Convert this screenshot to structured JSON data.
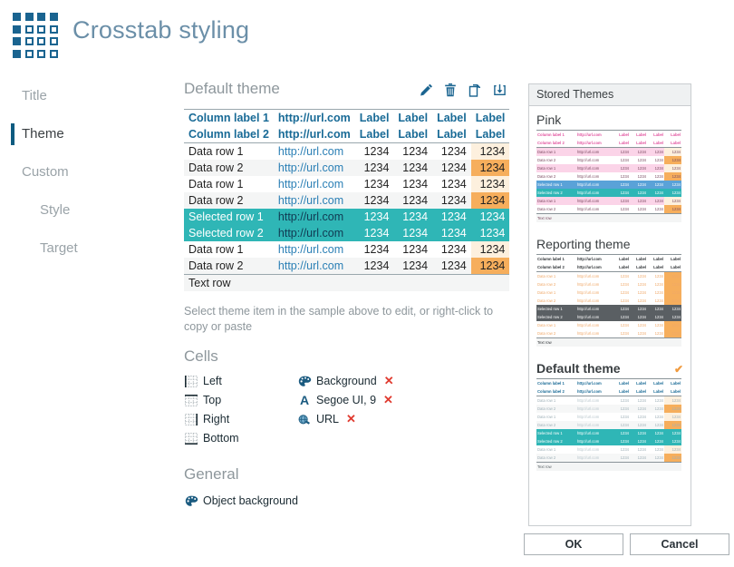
{
  "header": {
    "title": "Crosstab styling",
    "logo_icon": "grid-logo-icon"
  },
  "sidebar": {
    "items": [
      {
        "label": "Title",
        "active": false,
        "indent": false
      },
      {
        "label": "Theme",
        "active": true,
        "indent": false
      },
      {
        "label": "Custom",
        "active": false,
        "indent": false
      },
      {
        "label": "Style",
        "active": false,
        "indent": true
      },
      {
        "label": "Target",
        "active": false,
        "indent": true
      }
    ]
  },
  "main": {
    "panel_title": "Default theme",
    "toolbar": [
      {
        "name": "edit-pencil-icon",
        "tooltip": "Edit"
      },
      {
        "name": "delete-trash-icon",
        "tooltip": "Delete"
      },
      {
        "name": "copy-duplicate-icon",
        "tooltip": "Copy"
      },
      {
        "name": "import-download-icon",
        "tooltip": "Import"
      }
    ],
    "hint": "Select theme item in the sample above to edit, or right-click to copy or paste",
    "sample_table": {
      "rows": [
        {
          "type": "header",
          "cells": [
            "Column label 1",
            "http://url.com",
            "Label",
            "Label",
            "Label",
            "Label"
          ]
        },
        {
          "type": "header",
          "cells": [
            "Column label 2",
            "http://url.com",
            "Label",
            "Label",
            "Label",
            "Label"
          ]
        },
        {
          "type": "data",
          "alt": false,
          "cells": [
            "Data row 1",
            "http://url.com",
            "1234",
            "1234",
            "1234",
            "1234"
          ],
          "hl": "light"
        },
        {
          "type": "data",
          "alt": true,
          "cells": [
            "Data row 2",
            "http://url.com",
            "1234",
            "1234",
            "1234",
            "1234"
          ],
          "hl": "strong"
        },
        {
          "type": "data",
          "alt": false,
          "cells": [
            "Data row 1",
            "http://url.com",
            "1234",
            "1234",
            "1234",
            "1234"
          ],
          "hl": "light"
        },
        {
          "type": "data",
          "alt": true,
          "cells": [
            "Data row 2",
            "http://url.com",
            "1234",
            "1234",
            "1234",
            "1234"
          ],
          "hl": "strong"
        },
        {
          "type": "selected",
          "cells": [
            "Selected row 1",
            "http://url.com",
            "1234",
            "1234",
            "1234",
            "1234"
          ]
        },
        {
          "type": "selected",
          "cells": [
            "Selected row 2",
            "http://url.com",
            "1234",
            "1234",
            "1234",
            "1234"
          ]
        },
        {
          "type": "data",
          "alt": false,
          "cells": [
            "Data row 1",
            "http://url.com",
            "1234",
            "1234",
            "1234",
            "1234"
          ],
          "hl": "light"
        },
        {
          "type": "data",
          "alt": true,
          "cells": [
            "Data row 2",
            "http://url.com",
            "1234",
            "1234",
            "1234",
            "1234"
          ],
          "hl": "strong"
        },
        {
          "type": "text",
          "cells": [
            "Text row",
            "",
            "",
            "",
            "",
            ""
          ]
        }
      ]
    },
    "cells_section": {
      "title": "Cells",
      "borders": [
        {
          "label": "Left",
          "icon": "border-left-icon"
        },
        {
          "label": "Top",
          "icon": "border-top-icon"
        },
        {
          "label": "Right",
          "icon": "border-right-icon"
        },
        {
          "label": "Bottom",
          "icon": "border-bottom-icon"
        }
      ],
      "props": [
        {
          "label": "Background",
          "icon": "palette-icon",
          "clear": "✕"
        },
        {
          "label": "Segoe UI, 9",
          "icon": "font-letter-icon",
          "clear": "✕"
        },
        {
          "label": "URL",
          "icon": "link-globe-icon",
          "clear": "✕"
        }
      ]
    },
    "general_section": {
      "title": "General",
      "items": [
        {
          "label": "Object background",
          "icon": "palette-icon"
        }
      ]
    }
  },
  "stored_themes": {
    "header": "Stored Themes",
    "selected_mark": "✔",
    "themes": [
      {
        "name": "Pink",
        "selected": false,
        "rows": [
          {
            "type": "header",
            "cells": [
              "Column label 1",
              "http://url.com",
              "Label",
              "Label",
              "Label",
              "Label"
            ]
          },
          {
            "type": "header",
            "cells": [
              "Column label 2",
              "http://url.com",
              "Label",
              "Label",
              "Label",
              "Label"
            ]
          },
          {
            "type": "data",
            "alt": true,
            "cells": [
              "Data row 1",
              "http://url.com",
              "1234",
              "1234",
              "1234",
              "1234"
            ],
            "hl": "light"
          },
          {
            "type": "data",
            "alt": false,
            "cells": [
              "Data row 2",
              "http://url.com",
              "1234",
              "1234",
              "1234",
              "1234"
            ],
            "hl": "strong"
          },
          {
            "type": "data",
            "alt": true,
            "cells": [
              "Data row 1",
              "http://url.com",
              "1234",
              "1234",
              "1234",
              "1234"
            ],
            "hl": "light"
          },
          {
            "type": "data",
            "alt": false,
            "cells": [
              "Data row 2",
              "http://url.com",
              "1234",
              "1234",
              "1234",
              "1234"
            ],
            "hl": "strong"
          },
          {
            "type": "sel1",
            "cells": [
              "Selected row 1",
              "http://url.com",
              "1234",
              "1234",
              "1234",
              "1234"
            ]
          },
          {
            "type": "sel2",
            "cells": [
              "Selected row 2",
              "http://url.com",
              "1234",
              "1234",
              "1234",
              "1234"
            ]
          },
          {
            "type": "data",
            "alt": true,
            "cells": [
              "Data row 1",
              "http://url.com",
              "1234",
              "1234",
              "1234",
              "1234"
            ],
            "hl": "light"
          },
          {
            "type": "data",
            "alt": false,
            "cells": [
              "Data row 2",
              "http://url.com",
              "1234",
              "1234",
              "1234",
              "1234"
            ],
            "hl": "strong"
          },
          {
            "type": "text",
            "cells": [
              "Text row",
              "",
              "",
              "",
              "",
              ""
            ]
          }
        ]
      },
      {
        "name": "Reporting theme",
        "selected": false,
        "rows": [
          {
            "type": "header",
            "cells": [
              "Column label 1",
              "http://url.com",
              "Label",
              "Label",
              "Label",
              "Label"
            ]
          },
          {
            "type": "header",
            "cells": [
              "Column label 2",
              "http://url.com",
              "Label",
              "Label",
              "Label",
              "Label"
            ]
          },
          {
            "type": "data",
            "alt": false,
            "cells": [
              "Data row 1",
              "http://url.com",
              "1234",
              "1234",
              "1234",
              "1234"
            ],
            "hl": "strong"
          },
          {
            "type": "data",
            "alt": false,
            "cells": [
              "Data row 2",
              "http://url.com",
              "1234",
              "1234",
              "1234",
              "1234"
            ],
            "hl": "strong"
          },
          {
            "type": "data",
            "alt": false,
            "cells": [
              "Data row 1",
              "http://url.com",
              "1234",
              "1234",
              "1234",
              "1234"
            ],
            "hl": "strong"
          },
          {
            "type": "data",
            "alt": false,
            "cells": [
              "Data row 2",
              "http://url.com",
              "1234",
              "1234",
              "1234",
              "1234"
            ],
            "hl": "strong"
          },
          {
            "type": "sel1",
            "cells": [
              "Selected row 1",
              "http://url.com",
              "1234",
              "1234",
              "1234",
              "1234"
            ]
          },
          {
            "type": "sel2",
            "cells": [
              "Selected row 2",
              "http://url.com",
              "1234",
              "1234",
              "1234",
              "1234"
            ]
          },
          {
            "type": "data",
            "alt": false,
            "cells": [
              "Data row 1",
              "http://url.com",
              "1234",
              "1234",
              "1234",
              "1234"
            ],
            "hl": "strong"
          },
          {
            "type": "data",
            "alt": false,
            "cells": [
              "Data row 2",
              "http://url.com",
              "1234",
              "1234",
              "1234",
              "1234"
            ],
            "hl": "strong"
          },
          {
            "type": "text",
            "cells": [
              "Text row",
              "",
              "",
              "",
              "",
              ""
            ]
          }
        ]
      },
      {
        "name": "Default theme",
        "selected": true,
        "rows": [
          {
            "type": "header",
            "cells": [
              "Column label 1",
              "http://url.com",
              "Label",
              "Label",
              "Label",
              "Label"
            ]
          },
          {
            "type": "header",
            "cells": [
              "Column label 2",
              "http://url.com",
              "Label",
              "Label",
              "Label",
              "Label"
            ]
          },
          {
            "type": "data",
            "alt": false,
            "cells": [
              "Data row 1",
              "http://url.com",
              "1234",
              "1234",
              "1234",
              "1234"
            ],
            "hl": "light"
          },
          {
            "type": "data",
            "alt": true,
            "cells": [
              "Data row 2",
              "http://url.com",
              "1234",
              "1234",
              "1234",
              "1234"
            ],
            "hl": "strong"
          },
          {
            "type": "data",
            "alt": false,
            "cells": [
              "Data row 1",
              "http://url.com",
              "1234",
              "1234",
              "1234",
              "1234"
            ],
            "hl": "light"
          },
          {
            "type": "data",
            "alt": true,
            "cells": [
              "Data row 2",
              "http://url.com",
              "1234",
              "1234",
              "1234",
              "1234"
            ],
            "hl": "strong"
          },
          {
            "type": "sel1",
            "cells": [
              "Selected row 1",
              "http://url.com",
              "1234",
              "1234",
              "1234",
              "1234"
            ]
          },
          {
            "type": "sel2",
            "cells": [
              "Selected row 2",
              "http://url.com",
              "1234",
              "1234",
              "1234",
              "1234"
            ]
          },
          {
            "type": "data",
            "alt": false,
            "cells": [
              "Data row 1",
              "http://url.com",
              "1234",
              "1234",
              "1234",
              "1234"
            ],
            "hl": "light"
          },
          {
            "type": "data",
            "alt": true,
            "cells": [
              "Data row 2",
              "http://url.com",
              "1234",
              "1234",
              "1234",
              "1234"
            ],
            "hl": "strong"
          },
          {
            "type": "text",
            "cells": [
              "Text row",
              "",
              "",
              "",
              "",
              ""
            ]
          }
        ]
      }
    ]
  },
  "footer": {
    "ok_label": "OK",
    "cancel_label": "Cancel"
  },
  "colors": {
    "accent_blue": "#186a96",
    "logo_blue": "#1a6490",
    "selected_teal": "#2fb6b6",
    "highlight_light": "#fdf0de",
    "highlight_strong": "#f6ae5c",
    "pink": "#e255a0",
    "report_orange": "#f0a868",
    "clear_red": "#e03a2f"
  }
}
